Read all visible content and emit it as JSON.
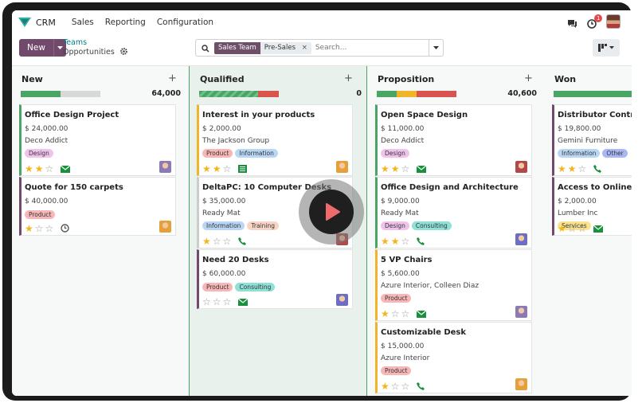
{
  "app": {
    "name": "CRM",
    "menu": [
      "Sales",
      "Reporting",
      "Configuration"
    ],
    "notification_count": "1"
  },
  "control": {
    "new_label": "New",
    "breadcrumb_parent": "Teams",
    "breadcrumb_current": "Opportunities",
    "search_facet_type": "Sales Team",
    "search_facet_value": "Pre-Sales",
    "search_placeholder": "Search..."
  },
  "colors": {
    "accent": "#71496a",
    "link": "#017e84",
    "green": "#4aa564",
    "star": "#f3b51a"
  },
  "columns": [
    {
      "title": "New",
      "total": "64,000",
      "progress": [
        {
          "color": "#4aa564",
          "pct": 0.5
        },
        {
          "color": "#d8d8d8",
          "pct": 0.5
        }
      ],
      "cards": [
        {
          "title": "Office Design Project",
          "amount": "$ 24,000.00",
          "customer": "Deco Addict",
          "tags": [
            {
              "label": "Design",
              "color": "#f0c3ec"
            }
          ],
          "stars": 2,
          "activity": "email-icon",
          "border": "#4aa564"
        },
        {
          "title": "Quote for 150 carpets",
          "amount": "$ 40,000.00",
          "customer": "",
          "tags": [
            {
              "label": "Product",
              "color": "#f7b7b7"
            }
          ],
          "stars": 1,
          "activity": "clock-icon",
          "border": "#71496a"
        }
      ]
    },
    {
      "title": "Qualified",
      "total": "0",
      "progress": [
        {
          "color": "#4aa564",
          "pct": 0.74
        },
        {
          "color": "#d9534f",
          "pct": 0.26
        }
      ],
      "cards": [
        {
          "title": "Interest in your products",
          "amount": "$ 2,000.00",
          "customer": "The Jackson Group",
          "tags": [
            {
              "label": "Product",
              "color": "#f7b7b7"
            },
            {
              "label": "Information",
              "color": "#b9d7f5"
            }
          ],
          "stars": 2,
          "activity": "list-icon",
          "border": "#f0b429"
        },
        {
          "title": "DeltaPC: 10 Computer Desks",
          "amount": "$ 35,000.00",
          "customer": "Ready Mat",
          "tags": [
            {
              "label": "Information",
              "color": "#b9d7f5"
            },
            {
              "label": "Training",
              "color": "#f9d5c5"
            }
          ],
          "stars": 1,
          "activity": "phone-icon",
          "border": "#ccc"
        },
        {
          "title": "Need 20 Desks",
          "amount": "$ 60,000.00",
          "customer": "",
          "tags": [
            {
              "label": "Product",
              "color": "#f7b7b7"
            },
            {
              "label": "Consulting",
              "color": "#8fe0d6"
            }
          ],
          "stars": 0,
          "activity": "email-icon",
          "border": "#71496a"
        }
      ]
    },
    {
      "title": "Proposition",
      "total": "40,600",
      "progress": [
        {
          "color": "#4aa564",
          "pct": 0.25
        },
        {
          "color": "#f0b429",
          "pct": 0.25
        },
        {
          "color": "#d9534f",
          "pct": 0.5
        }
      ],
      "cards": [
        {
          "title": "Open Space Design",
          "amount": "$ 11,000.00",
          "customer": "Deco Addict",
          "tags": [
            {
              "label": "Design",
              "color": "#f0c3ec"
            }
          ],
          "stars": 2,
          "activity": "email-icon",
          "border": "#4aa564"
        },
        {
          "title": "Office Design and Architecture",
          "amount": "$ 9,000.00",
          "customer": "Ready Mat",
          "tags": [
            {
              "label": "Design",
              "color": "#f0c3ec"
            },
            {
              "label": "Consulting",
              "color": "#8fe0d6"
            }
          ],
          "stars": 2,
          "activity": "phone-icon",
          "border": "#4aa564"
        },
        {
          "title": "5 VP Chairs",
          "amount": "$ 5,600.00",
          "customer": "Azure Interior, Colleen Diaz",
          "tags": [
            {
              "label": "Product",
              "color": "#f7b7b7"
            }
          ],
          "stars": 1,
          "activity": "email-icon",
          "border": "#f0b429"
        },
        {
          "title": "Customizable Desk",
          "amount": "$ 15,000.00",
          "customer": "Azure Interior",
          "tags": [
            {
              "label": "Product",
              "color": "#f7b7b7"
            }
          ],
          "stars": 1,
          "activity": "phone-icon",
          "border": "#f0b429"
        }
      ]
    },
    {
      "title": "Won",
      "total": "",
      "progress": [
        {
          "color": "#4aa564",
          "pct": 1
        }
      ],
      "cards": [
        {
          "title": "Distributor Contract",
          "amount": "$ 19,800.00",
          "customer": "Gemini Furniture",
          "tags": [
            {
              "label": "Information",
              "color": "#b9d7f5"
            },
            {
              "label": "Other",
              "color": "#a9b8f5"
            }
          ],
          "stars": 2,
          "activity": "phone-icon",
          "border": "#71496a"
        },
        {
          "title": "Access to Online Catalog",
          "amount": "$ 2,000.00",
          "customer": "Lumber Inc",
          "tags": [
            {
              "label": "Services",
              "color": "#fbe38e"
            }
          ],
          "stars": 1,
          "activity": "email-icon",
          "border": "#71496a"
        }
      ]
    }
  ]
}
